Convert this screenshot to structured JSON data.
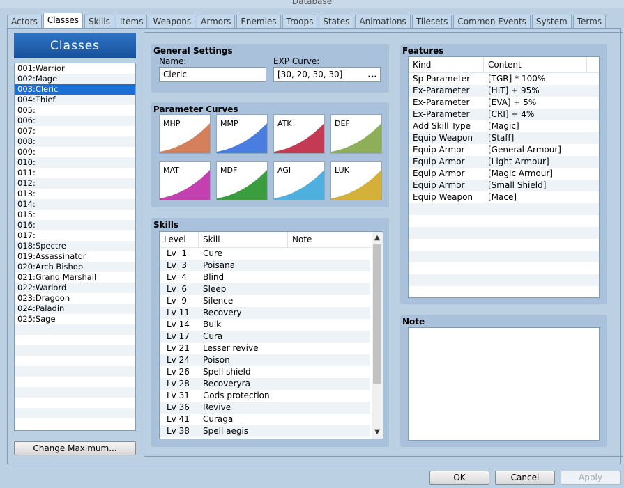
{
  "window": {
    "title": "Database"
  },
  "tabs": [
    {
      "label": "Actors"
    },
    {
      "label": "Classes"
    },
    {
      "label": "Skills"
    },
    {
      "label": "Items"
    },
    {
      "label": "Weapons"
    },
    {
      "label": "Armors"
    },
    {
      "label": "Enemies"
    },
    {
      "label": "Troops"
    },
    {
      "label": "States"
    },
    {
      "label": "Animations"
    },
    {
      "label": "Tilesets"
    },
    {
      "label": "Common Events"
    },
    {
      "label": "System"
    },
    {
      "label": "Terms"
    }
  ],
  "classes_panel": {
    "header": "Classes",
    "items": [
      "001:Warrior",
      "002:Mage",
      "003:Cleric",
      "004:Thief",
      "005:",
      "006:",
      "007:",
      "008:",
      "009:",
      "010:",
      "011:",
      "012:",
      "013:",
      "014:",
      "015:",
      "016:",
      "017:",
      "018:Spectre",
      "019:Assassinator",
      "020:Arch Bishop",
      "021:Grand Marshall",
      "022:Warlord",
      "023:Dragoon",
      "024:Paladin",
      "025:Sage"
    ],
    "selected_index": 2,
    "change_max_label": "Change Maximum..."
  },
  "general": {
    "title": "General Settings",
    "name_label": "Name:",
    "name_value": "Cleric",
    "exp_label": "EXP Curve:",
    "exp_value": "[30, 20, 30, 30]",
    "exp_button": "..."
  },
  "curves": {
    "title": "Parameter Curves",
    "items": [
      {
        "label": "MHP",
        "color": "#d4805a"
      },
      {
        "label": "MMP",
        "color": "#4a7de0"
      },
      {
        "label": "ATK",
        "color": "#c43a55"
      },
      {
        "label": "DEF",
        "color": "#8fae5a"
      },
      {
        "label": "MAT",
        "color": "#c43fb0"
      },
      {
        "label": "MDF",
        "color": "#3a9e3f"
      },
      {
        "label": "AGI",
        "color": "#4fb0e0"
      },
      {
        "label": "LUK",
        "color": "#d4b03a"
      }
    ]
  },
  "skills": {
    "title": "Skills",
    "columns": [
      "Level",
      "Skill",
      "Note"
    ],
    "rows": [
      {
        "level": "Lv  1",
        "skill": "Cure",
        "note": ""
      },
      {
        "level": "Lv  3",
        "skill": "Poisana",
        "note": ""
      },
      {
        "level": "Lv  4",
        "skill": "Blind",
        "note": ""
      },
      {
        "level": "Lv  6",
        "skill": "Sleep",
        "note": ""
      },
      {
        "level": "Lv  9",
        "skill": "Silence",
        "note": ""
      },
      {
        "level": "Lv 11",
        "skill": "Recovery",
        "note": ""
      },
      {
        "level": "Lv 14",
        "skill": "Bulk",
        "note": ""
      },
      {
        "level": "Lv 17",
        "skill": "Cura",
        "note": ""
      },
      {
        "level": "Lv 21",
        "skill": "Lesser revive",
        "note": ""
      },
      {
        "level": "Lv 24",
        "skill": "Poison",
        "note": ""
      },
      {
        "level": "Lv 26",
        "skill": "Spell shield",
        "note": ""
      },
      {
        "level": "Lv 28",
        "skill": "Recoveryra",
        "note": ""
      },
      {
        "level": "Lv 31",
        "skill": "Gods protection",
        "note": ""
      },
      {
        "level": "Lv 36",
        "skill": "Revive",
        "note": ""
      },
      {
        "level": "Lv 41",
        "skill": "Curaga",
        "note": ""
      },
      {
        "level": "Lv 38",
        "skill": "Spell aegis",
        "note": ""
      }
    ]
  },
  "features": {
    "title": "Features",
    "columns": [
      "Kind",
      "Content"
    ],
    "rows": [
      {
        "kind": "Sp-Parameter",
        "content": "[TGR] * 100%"
      },
      {
        "kind": "Ex-Parameter",
        "content": "[HIT] + 95%"
      },
      {
        "kind": "Ex-Parameter",
        "content": "[EVA] + 5%"
      },
      {
        "kind": "Ex-Parameter",
        "content": "[CRI] + 4%"
      },
      {
        "kind": "Add Skill Type",
        "content": "[Magic]"
      },
      {
        "kind": "Equip Weapon",
        "content": "[Staff]"
      },
      {
        "kind": "Equip Armor",
        "content": "[General Armour]"
      },
      {
        "kind": "Equip Armor",
        "content": "[Light Armour]"
      },
      {
        "kind": "Equip Armor",
        "content": "[Magic Armour]"
      },
      {
        "kind": "Equip Armor",
        "content": "[Small Shield]"
      },
      {
        "kind": "Equip Weapon",
        "content": "[Mace]"
      }
    ]
  },
  "note": {
    "title": "Note",
    "value": ""
  },
  "buttons": {
    "ok": "OK",
    "cancel": "Cancel",
    "apply": "Apply"
  }
}
